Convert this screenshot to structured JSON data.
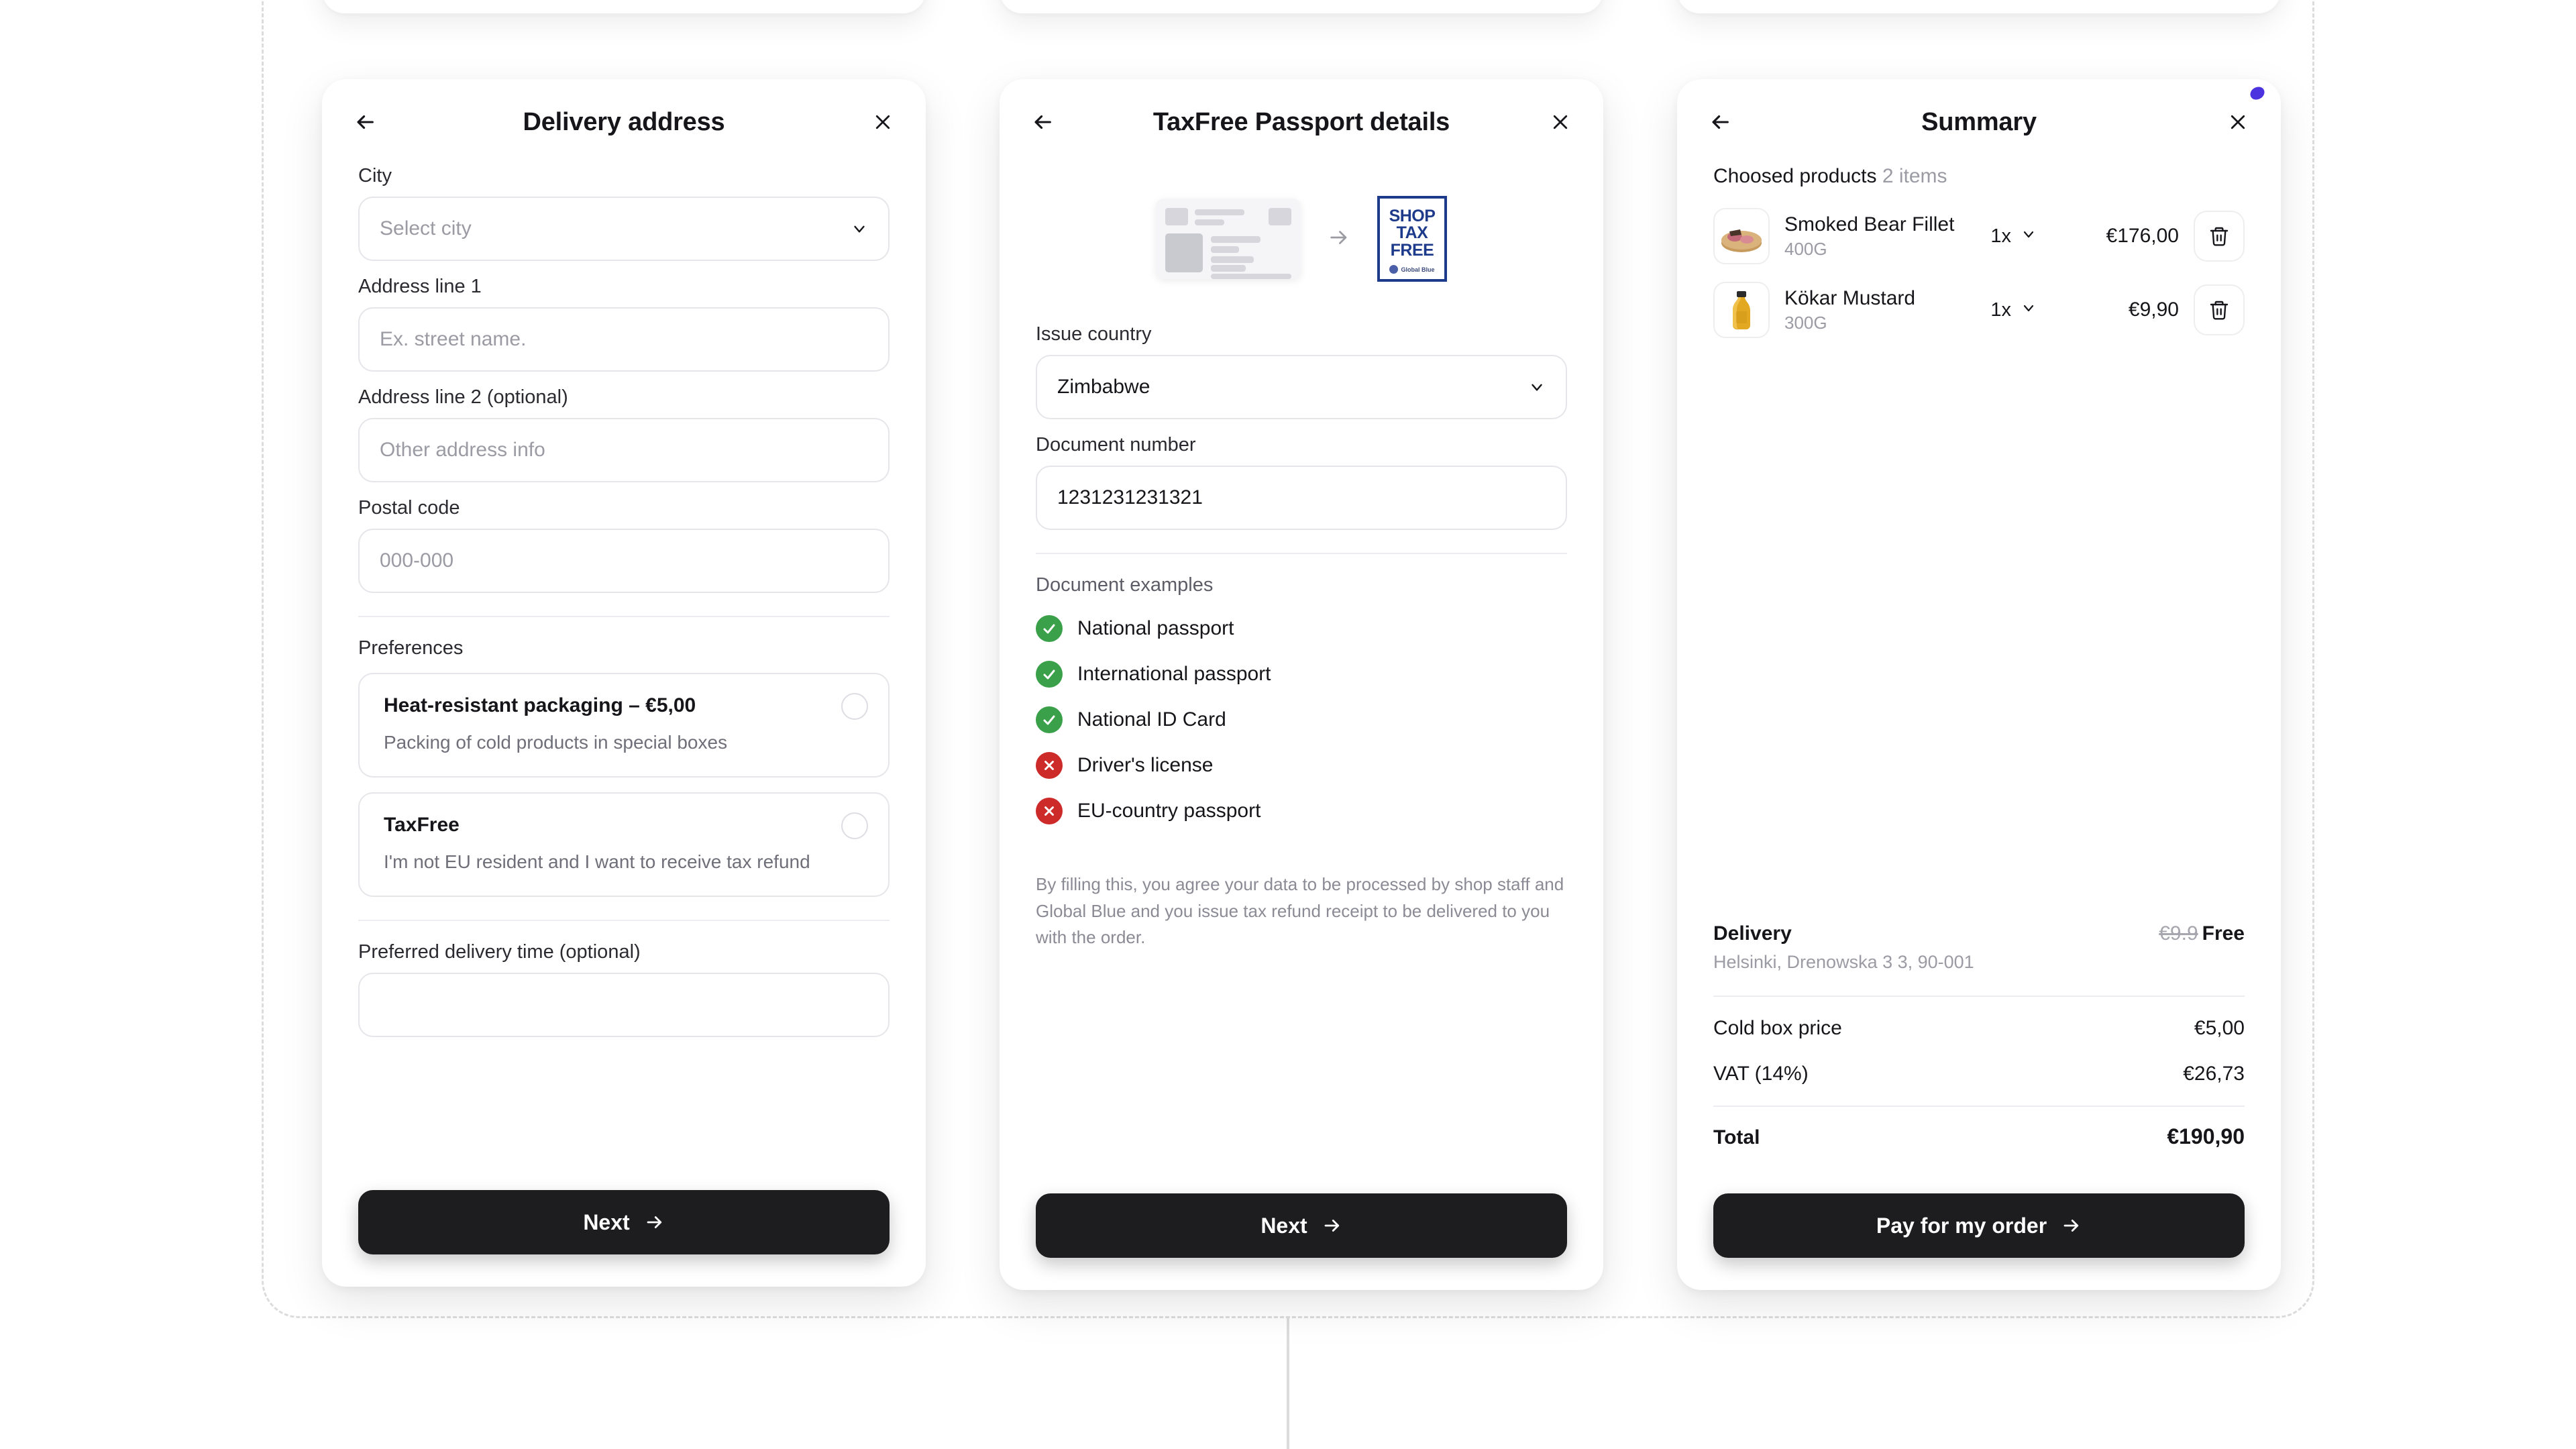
{
  "cards": {
    "delivery": {
      "title": "Delivery address",
      "back_icon": "arrow-left-icon",
      "close_icon": "close-icon",
      "fields": [
        {
          "label": "City",
          "type": "select",
          "value": "",
          "placeholder": "Select city"
        },
        {
          "label": "Address line 1",
          "type": "text",
          "value": "",
          "placeholder": "Ex. street name."
        },
        {
          "label": "Address line 2 (optional)",
          "type": "text",
          "value": "",
          "placeholder": "Other address info"
        },
        {
          "label": "Postal code",
          "type": "text",
          "value": "",
          "placeholder": "000-000"
        }
      ],
      "preferences_label": "Preferences",
      "preferences": [
        {
          "title": "Heat-resistant packaging – €5,00",
          "subtitle": "Packing of cold products in special boxes",
          "selected": false
        },
        {
          "title": "TaxFree",
          "subtitle": "I'm not EU resident and I want to receive tax refund",
          "selected": false
        }
      ],
      "delivery_time_label": "Preferred delivery time (optional)",
      "cta_label": "Next"
    },
    "taxfree": {
      "title": "TaxFree Passport details",
      "back_icon": "arrow-left-icon",
      "close_icon": "close-icon",
      "illustration": {
        "document_icon": "id-document-icon",
        "arrow_icon": "arrow-right-icon",
        "logo_lines": [
          "SHOP",
          "TAX",
          "FREE"
        ],
        "logo_brand": "Global Blue"
      },
      "issue_country_label": "Issue country",
      "issue_country_value": "Zimbabwe",
      "document_number_label": "Document number",
      "document_number_value": "1231231231321",
      "examples_label": "Document examples",
      "examples": [
        {
          "text": "National passport",
          "status": "ok",
          "icon": "check-circle-icon"
        },
        {
          "text": "International passport",
          "status": "ok",
          "icon": "check-circle-icon"
        },
        {
          "text": "National ID Card",
          "status": "ok",
          "icon": "check-circle-icon"
        },
        {
          "text": "Driver's license",
          "status": "no",
          "icon": "x-circle-icon"
        },
        {
          "text": "EU-country passport",
          "status": "no",
          "icon": "x-circle-icon"
        }
      ],
      "disclaimer": "By filling this, you agree your data to be processed by shop staff and Global Blue and you issue tax refund receipt to be delivered to you with the order.",
      "cta_label": "Next"
    },
    "summary": {
      "title": "Summary",
      "back_icon": "arrow-left-icon",
      "close_icon": "close-icon",
      "chosen_label": "Choosed products",
      "chosen_count": "2 items",
      "products": [
        {
          "name": "Smoked Bear Fillet",
          "weight": "400G",
          "quantity": "1x",
          "price": "€176,00",
          "thumb": "smoked-meat-thumb",
          "delete_icon": "trash-icon"
        },
        {
          "name": "Kökar Mustard",
          "weight": "300G",
          "quantity": "1x",
          "price": "€9,90",
          "thumb": "mustard-bottle-thumb",
          "delete_icon": "trash-icon"
        }
      ],
      "delivery_label": "Delivery",
      "delivery_old_price": "€9.9",
      "delivery_price": "Free",
      "delivery_address": "Helsinki, Drenowska 3 3, 90-001",
      "lines": [
        {
          "label": "Cold box price",
          "value": "€5,00"
        },
        {
          "label": "VAT (14%)",
          "value": "€26,73"
        }
      ],
      "total_label": "Total",
      "total_value": "€190,90",
      "cta_label": "Pay for my order"
    }
  },
  "colors": {
    "cta_background": "#1d1d1f",
    "ok": "#3aa049",
    "no": "#cd2a2a",
    "logo_blue": "#1e3a8a",
    "muted": "#9b9ba4"
  }
}
